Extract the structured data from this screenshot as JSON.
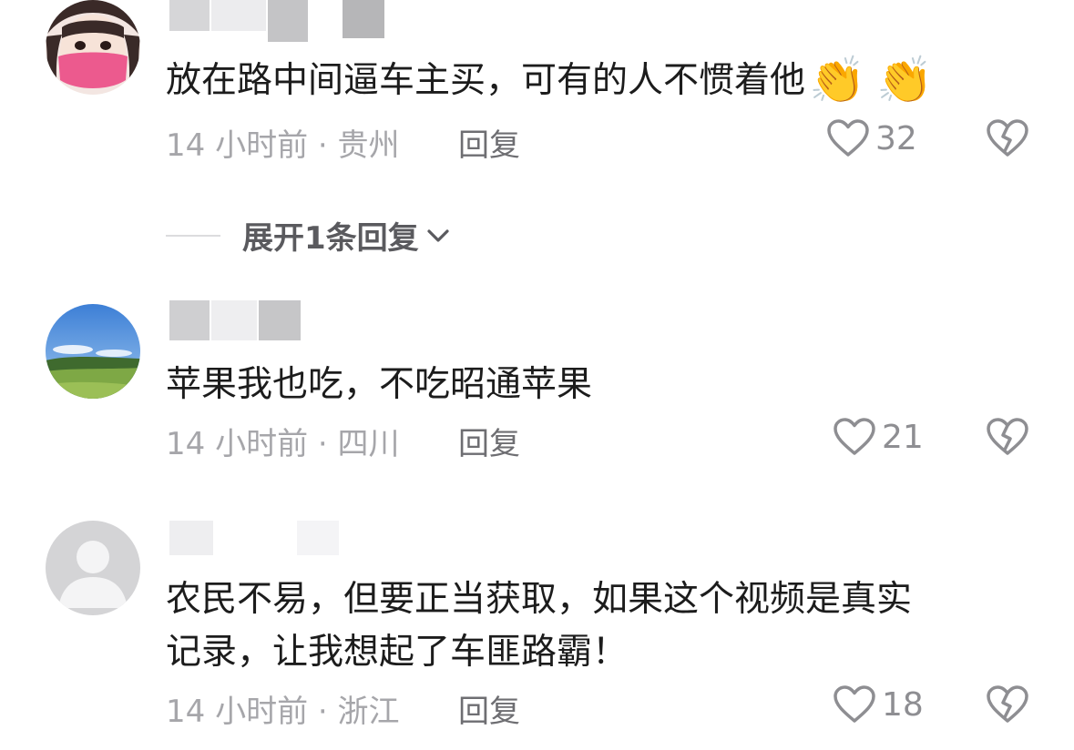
{
  "comments": [
    {
      "text": "放在路中间逼车主买，可有的人不惯着他",
      "emojis": [
        "👏",
        "👏"
      ],
      "time": "14 小时前",
      "location": "贵州",
      "reply_label": "回复",
      "likes": "32",
      "avatar_icon": "girl-pink-mask-avatar"
    },
    {
      "text": "苹果我也吃，不吃昭通苹果",
      "time": "14 小时前",
      "location": "四川",
      "reply_label": "回复",
      "likes": "21",
      "avatar_icon": "landscape-avatar"
    },
    {
      "text_line1": "农民不易，但要正当获取，如果这个视频是真实",
      "text_line2": "记录，让我想起了车匪路霸！",
      "time": "14 小时前",
      "location": "浙江",
      "reply_label": "回复",
      "likes": "18",
      "avatar_icon": "default-user-avatar"
    }
  ],
  "expand": {
    "label": "展开1条回复"
  },
  "meta_separator": "·",
  "colors": {
    "text": "#1c1c1c",
    "meta": "#a6a6aa",
    "icon": "#8e8e92"
  }
}
